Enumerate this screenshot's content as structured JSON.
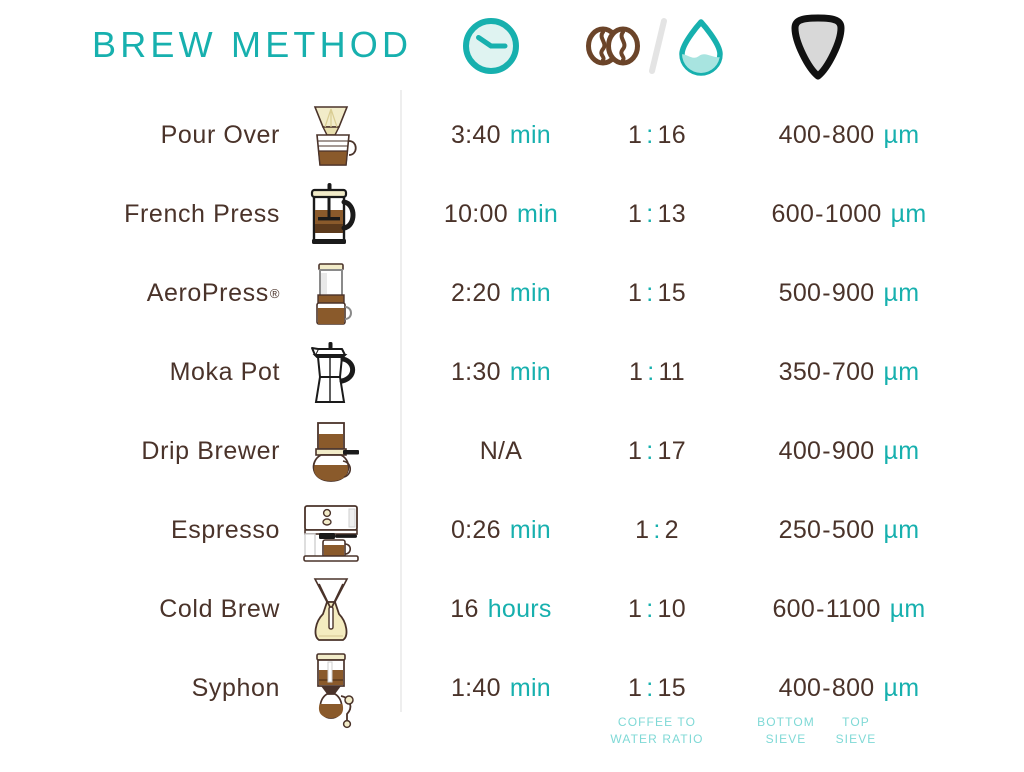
{
  "title": "BREW METHOD",
  "colors": {
    "teal": "#17b0ae",
    "teal_light": "#7fd9d6",
    "teal_pale": "#d9f2f0",
    "brown": "#4a332a",
    "bean_brown": "#6b4429",
    "divider_gray": "#eeeeee",
    "sieve_gray": "#d8d8d8",
    "background": "#ffffff"
  },
  "header": {
    "icons": [
      {
        "name": "clock-icon",
        "meaning": "brew time"
      },
      {
        "name": "coffee-beans-icon",
        "meaning": "coffee"
      },
      {
        "name": "slash-icon",
        "meaning": "per"
      },
      {
        "name": "water-drop-icon",
        "meaning": "water"
      },
      {
        "name": "sieve-icon",
        "meaning": "grind size sieve"
      }
    ]
  },
  "columns": {
    "method": "BREW METHOD",
    "time": "time",
    "ratio": "coffee to water ratio",
    "grind": "grind size"
  },
  "rows": [
    {
      "method": "Pour Over",
      "trademark": "",
      "icon": "pour-over-icon",
      "time_value": "3:40",
      "time_unit": "min",
      "ratio_left": "1",
      "ratio_right": "16",
      "grind_min": "400",
      "grind_max": "800",
      "grind_unit": "µm"
    },
    {
      "method": "French Press",
      "trademark": "",
      "icon": "french-press-icon",
      "time_value": "10:00",
      "time_unit": "min",
      "ratio_left": "1",
      "ratio_right": "13",
      "grind_min": "600",
      "grind_max": "1000",
      "grind_unit": "µm"
    },
    {
      "method": "AeroPress",
      "trademark": "®",
      "icon": "aeropress-icon",
      "time_value": "2:20",
      "time_unit": "min",
      "ratio_left": "1",
      "ratio_right": "15",
      "grind_min": "500",
      "grind_max": "900",
      "grind_unit": "µm"
    },
    {
      "method": "Moka Pot",
      "trademark": "",
      "icon": "moka-pot-icon",
      "time_value": "1:30",
      "time_unit": "min",
      "ratio_left": "1",
      "ratio_right": "11",
      "grind_min": "350",
      "grind_max": "700",
      "grind_unit": "µm"
    },
    {
      "method": "Drip Brewer",
      "trademark": "",
      "icon": "drip-brewer-icon",
      "time_value": "N/A",
      "time_unit": "",
      "ratio_left": "1",
      "ratio_right": "17",
      "grind_min": "400",
      "grind_max": "900",
      "grind_unit": "µm"
    },
    {
      "method": "Espresso",
      "trademark": "",
      "icon": "espresso-machine-icon",
      "time_value": "0:26",
      "time_unit": "min",
      "ratio_left": "1",
      "ratio_right": "2",
      "grind_min": "250",
      "grind_max": "500",
      "grind_unit": "µm"
    },
    {
      "method": "Cold Brew",
      "trademark": "",
      "icon": "cold-brew-icon",
      "time_value": "16",
      "time_unit": "hours",
      "ratio_left": "1",
      "ratio_right": "10",
      "grind_min": "600",
      "grind_max": "1100",
      "grind_unit": "µm"
    },
    {
      "method": "Syphon",
      "trademark": "",
      "icon": "syphon-icon",
      "time_value": "1:40",
      "time_unit": "min",
      "ratio_left": "1",
      "ratio_right": "15",
      "grind_min": "400",
      "grind_max": "800",
      "grind_unit": "µm"
    }
  ],
  "footer": {
    "ratio_label": "COFFEE TO WATER RATIO",
    "bottom_sieve_label": "BOTTOM SIEVE",
    "top_sieve_label": "TOP SIEVE"
  }
}
